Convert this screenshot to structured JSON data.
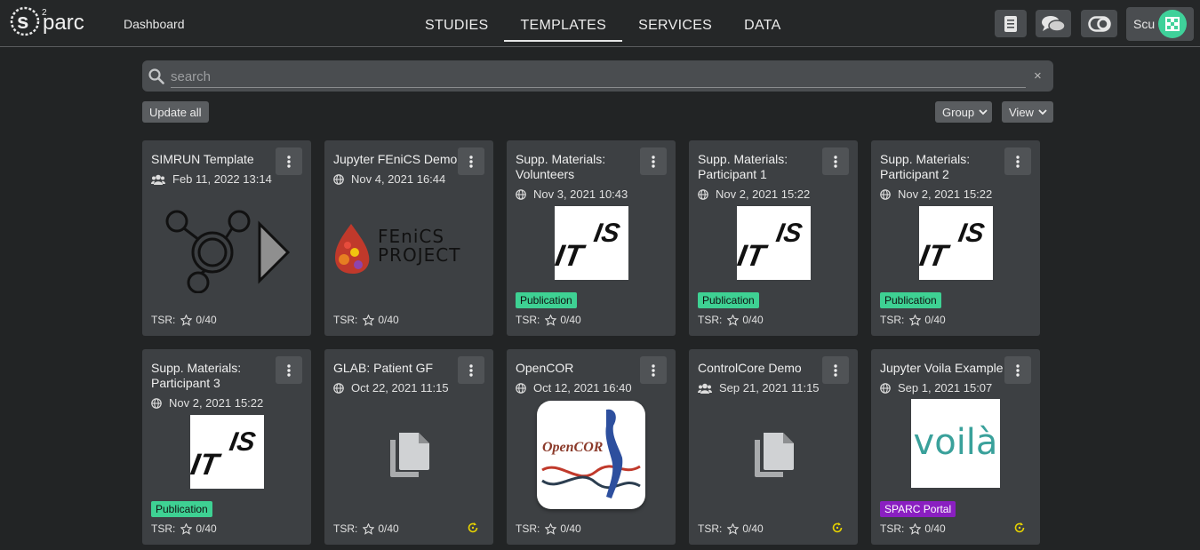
{
  "app": {
    "logo_text": "s²parc",
    "dashboard_label": "Dashboard",
    "user_initials": "Scu"
  },
  "nav_tabs": [
    {
      "label": "STUDIES",
      "active": false
    },
    {
      "label": "TEMPLATES",
      "active": true
    },
    {
      "label": "SERVICES",
      "active": false
    },
    {
      "label": "DATA",
      "active": false
    }
  ],
  "nav_icons": [
    "manual-icon",
    "chat-icon",
    "theme-toggle-icon"
  ],
  "search": {
    "placeholder": "search",
    "value": "",
    "clear_label": "×"
  },
  "toolbar": {
    "update_all": "Update all",
    "group": "Group",
    "view": "View"
  },
  "colors": {
    "accent": "#3ed193",
    "portal_tag": "#8a1fc1",
    "update_icon": "#e6d200"
  },
  "cards": [
    {
      "title": "SIMRUN Template",
      "access": "shared",
      "date": "Feb 11, 2022 13:14",
      "thumbnail": "simrun-graph",
      "tag": "",
      "tsr": "TSR:",
      "tsr_value": "0/40",
      "update": false
    },
    {
      "title": "Jupyter FEniCS Demo",
      "access": "public",
      "date": "Nov 4, 2021 16:44",
      "thumbnail": "fenics-logo",
      "thumb_text_1": "FEniCS",
      "thumb_text_2": "PROJECT",
      "tag": "",
      "tsr": "TSR:",
      "tsr_value": "0/40",
      "update": false
    },
    {
      "title": "Supp. Materials: Volunteers",
      "access": "public",
      "date": "Nov 3, 2021 10:43",
      "thumbnail": "itis-logo",
      "tag": "Publication",
      "tsr": "TSR:",
      "tsr_value": "0/40",
      "update": false
    },
    {
      "title": "Supp. Materials: Participant 1",
      "access": "public",
      "date": "Nov 2, 2021 15:22",
      "thumbnail": "itis-logo",
      "tag": "Publication",
      "tsr": "TSR:",
      "tsr_value": "0/40",
      "update": false
    },
    {
      "title": "Supp. Materials: Participant 2",
      "access": "public",
      "date": "Nov 2, 2021 15:22",
      "thumbnail": "itis-logo",
      "tag": "Publication",
      "tsr": "TSR:",
      "tsr_value": "0/40",
      "update": false
    },
    {
      "title": "Supp. Materials: Participant 3",
      "access": "public",
      "date": "Nov 2, 2021 15:22",
      "thumbnail": "itis-logo",
      "tag": "Publication",
      "tsr": "TSR:",
      "tsr_value": "0/40",
      "update": false
    },
    {
      "title": "GLAB: Patient GF",
      "access": "public",
      "date": "Oct 22, 2021 11:15",
      "thumbnail": "copy-icon",
      "tag": "",
      "tsr": "TSR:",
      "tsr_value": "0/40",
      "update": true
    },
    {
      "title": "OpenCOR",
      "access": "public",
      "date": "Oct 12, 2021 16:40",
      "thumbnail": "opencor-logo",
      "thumb_text_1": "OpenCOR",
      "tag": "",
      "tsr": "TSR:",
      "tsr_value": "0/40",
      "update": false
    },
    {
      "title": "ControlCore Demo",
      "access": "shared",
      "date": "Sep 21, 2021 11:15",
      "thumbnail": "copy-icon",
      "tag": "",
      "tsr": "TSR:",
      "tsr_value": "0/40",
      "update": true
    },
    {
      "title": "Jupyter Voila Example",
      "access": "public",
      "date": "Sep 1, 2021 15:07",
      "thumbnail": "voila-logo",
      "thumb_text_1": "voilà",
      "tag": "SPARC Portal",
      "tsr": "TSR:",
      "tsr_value": "0/40",
      "update": true
    }
  ]
}
